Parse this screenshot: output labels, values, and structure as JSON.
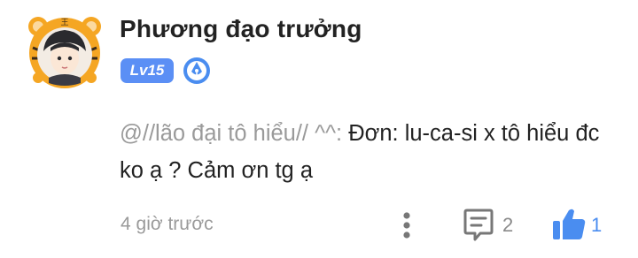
{
  "user": {
    "name": "Phương đạo trưởng",
    "level": "Lv15",
    "avatar_icon": "tiger-frame-avatar",
    "badge_icon": "pen-nib-icon"
  },
  "comment": {
    "mention": "@//lão đại tô hiểu// ^^:",
    "text": " Đơn: lu-ca-si x tô hiểu đc ko ạ ? Cảm ơn tg ạ"
  },
  "footer": {
    "timestamp": "4 giờ trước",
    "reply_count": "2",
    "like_count": "1"
  },
  "colors": {
    "accent": "#4a8df0",
    "level_badge": "#5b8ff5",
    "avatar_ring": "#f5a623"
  }
}
